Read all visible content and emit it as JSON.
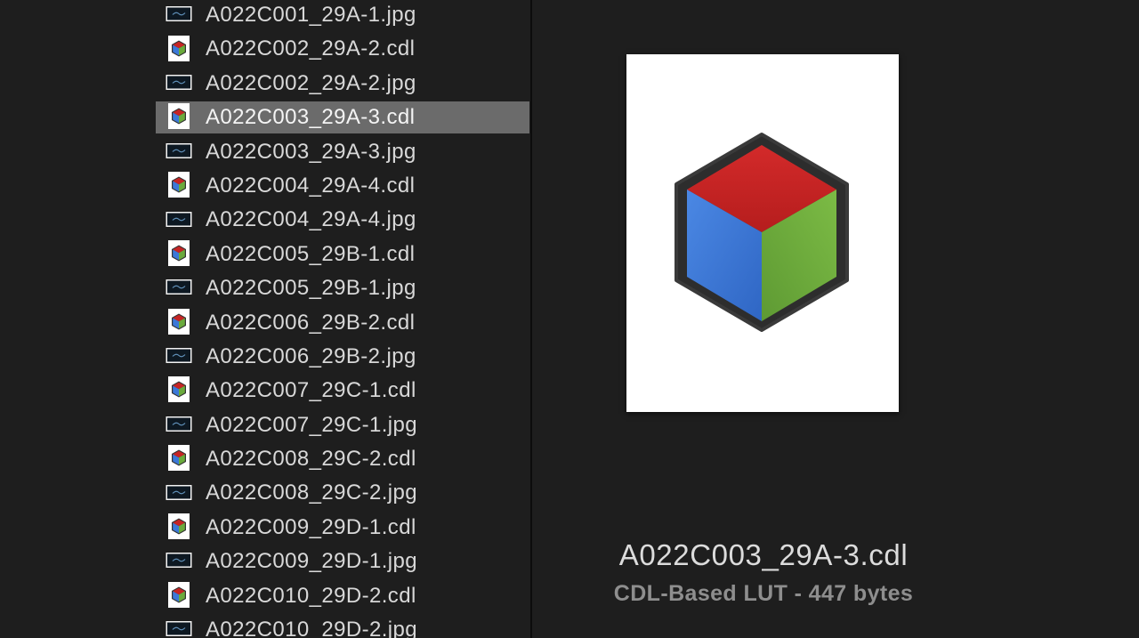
{
  "files": [
    {
      "name": "A022C001_29A-1.jpg",
      "type": "jpg",
      "selected": false
    },
    {
      "name": "A022C002_29A-2.cdl",
      "type": "cdl",
      "selected": false
    },
    {
      "name": "A022C002_29A-2.jpg",
      "type": "jpg",
      "selected": false
    },
    {
      "name": "A022C003_29A-3.cdl",
      "type": "cdl",
      "selected": true
    },
    {
      "name": "A022C003_29A-3.jpg",
      "type": "jpg",
      "selected": false
    },
    {
      "name": "A022C004_29A-4.cdl",
      "type": "cdl",
      "selected": false
    },
    {
      "name": "A022C004_29A-4.jpg",
      "type": "jpg",
      "selected": false
    },
    {
      "name": "A022C005_29B-1.cdl",
      "type": "cdl",
      "selected": false
    },
    {
      "name": "A022C005_29B-1.jpg",
      "type": "jpg",
      "selected": false
    },
    {
      "name": "A022C006_29B-2.cdl",
      "type": "cdl",
      "selected": false
    },
    {
      "name": "A022C006_29B-2.jpg",
      "type": "jpg",
      "selected": false
    },
    {
      "name": "A022C007_29C-1.cdl",
      "type": "cdl",
      "selected": false
    },
    {
      "name": "A022C007_29C-1.jpg",
      "type": "jpg",
      "selected": false
    },
    {
      "name": "A022C008_29C-2.cdl",
      "type": "cdl",
      "selected": false
    },
    {
      "name": "A022C008_29C-2.jpg",
      "type": "jpg",
      "selected": false
    },
    {
      "name": "A022C009_29D-1.cdl",
      "type": "cdl",
      "selected": false
    },
    {
      "name": "A022C009_29D-1.jpg",
      "type": "jpg",
      "selected": false
    },
    {
      "name": "A022C010_29D-2.cdl",
      "type": "cdl",
      "selected": false
    },
    {
      "name": "A022C010_29D-2.jpg",
      "type": "jpg",
      "selected": false
    }
  ],
  "icons": {
    "jpg": "image-thumbnail-icon",
    "cdl": "color-cube-document-icon"
  },
  "preview": {
    "filename": "A022C003_29A-3.cdl",
    "meta": "CDL-Based LUT - 447 bytes",
    "icon": "color-cube-icon"
  },
  "colors": {
    "background": "#1e1e1e",
    "selection": "#6b6b6b",
    "cube_top": "#c62424",
    "cube_left": "#3b78d8",
    "cube_right": "#6aaa3c",
    "cube_frame": "#2d2d2d"
  }
}
